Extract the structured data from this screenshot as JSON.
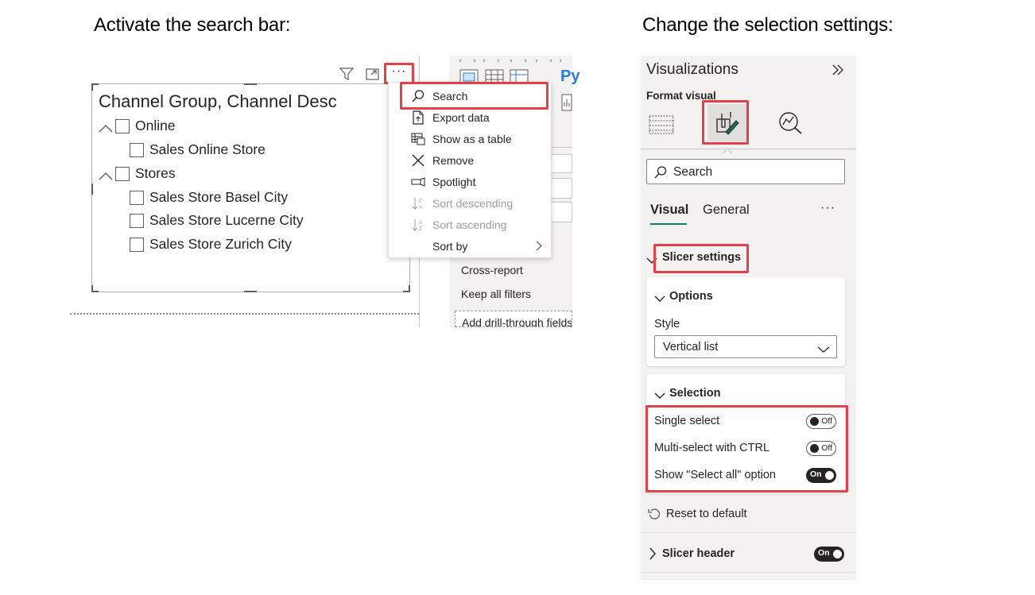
{
  "left_section": {
    "heading": "Activate the search bar:",
    "slicer": {
      "title": "Channel Group, Channel Desc",
      "tree": [
        {
          "label": "Online",
          "level": 0
        },
        {
          "label": "Sales Online Store",
          "level": 1
        },
        {
          "label": "Stores",
          "level": 0
        },
        {
          "label": "Sales Store Basel City",
          "level": 1
        },
        {
          "label": "Sales Store Lucerne City",
          "level": 1
        },
        {
          "label": "Sales Store Zurich City",
          "level": 1
        }
      ],
      "header_icons": [
        "filter-icon",
        "focus-mode-icon",
        "more-options-icon"
      ],
      "more_label": "···"
    },
    "context_menu": {
      "items": [
        {
          "label": "Search",
          "icon": "search-icon",
          "disabled": false
        },
        {
          "label": "Export data",
          "icon": "export-icon",
          "disabled": false
        },
        {
          "label": "Show as a table",
          "icon": "table-icon",
          "disabled": false
        },
        {
          "label": "Remove",
          "icon": "close-icon",
          "disabled": false
        },
        {
          "label": "Spotlight",
          "icon": "spotlight-icon",
          "disabled": false
        },
        {
          "label": "Sort descending",
          "icon": "sort-desc-icon",
          "disabled": true
        },
        {
          "label": "Sort ascending",
          "icon": "sort-asc-icon",
          "disabled": true
        },
        {
          "label": "Sort by",
          "icon": "",
          "disabled": false
        }
      ]
    },
    "side_pane": {
      "py_label": "Py",
      "cross_report": "Cross-report",
      "keep_filters": "Keep all filters",
      "drill_through": "Add drill-through fields"
    }
  },
  "right_section": {
    "heading": "Change the selection settings:",
    "pane": {
      "title": "Visualizations",
      "subtitle": "Format visual",
      "search_placeholder": "Search",
      "tabs": [
        "Visual",
        "General"
      ],
      "more_label": "···",
      "slicer_settings": "Slicer settings",
      "options": {
        "title": "Options",
        "style_label": "Style",
        "style_value": "Vertical list"
      },
      "selection": {
        "title": "Selection",
        "rows": [
          {
            "label": "Single select",
            "state": "Off"
          },
          {
            "label": "Multi-select with CTRL",
            "state": "Off"
          },
          {
            "label": "Show \"Select all\" option",
            "state": "On"
          }
        ]
      },
      "reset": "Reset to default",
      "slicer_header": {
        "label": "Slicer header",
        "state": "On"
      }
    }
  },
  "colors": {
    "highlight": "#e0414a",
    "pane_bg": "#f3f2f1",
    "tab_underline": "#117865",
    "text": "#252423",
    "disabled_text": "#a19f9d"
  }
}
